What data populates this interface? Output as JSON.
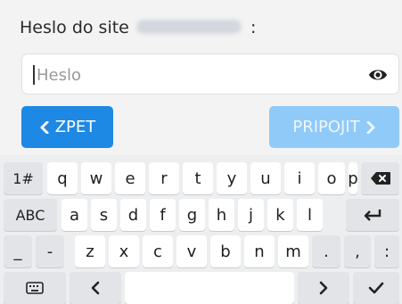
{
  "prompt": {
    "label": "Heslo do site",
    "suffix": ":"
  },
  "password": {
    "placeholder": "Heslo",
    "value": ""
  },
  "icons": {
    "reveal": "eye-icon",
    "back": "chevron-left-icon",
    "forward": "chevron-right-icon",
    "backspace": "backspace-icon",
    "enter": "enter-icon",
    "keyboard": "keyboard-icon",
    "left": "arrow-left-icon",
    "right": "arrow-right-icon",
    "done": "checkmark-icon"
  },
  "buttons": {
    "back": "ZPET",
    "connect": "PRIPOJIT"
  },
  "colors": {
    "primary": "#1e88e5",
    "primary_disabled": "#90caf9"
  },
  "keyboard": {
    "row1": [
      "1#",
      "q",
      "w",
      "e",
      "r",
      "t",
      "y",
      "u",
      "i",
      "o",
      "p"
    ],
    "row2": [
      "ABC",
      "a",
      "s",
      "d",
      "f",
      "g",
      "h",
      "j",
      "k",
      "l"
    ],
    "row3": [
      "_",
      "-",
      "z",
      "x",
      "c",
      "v",
      "b",
      "n",
      "m",
      ".",
      ",",
      ":"
    ]
  }
}
